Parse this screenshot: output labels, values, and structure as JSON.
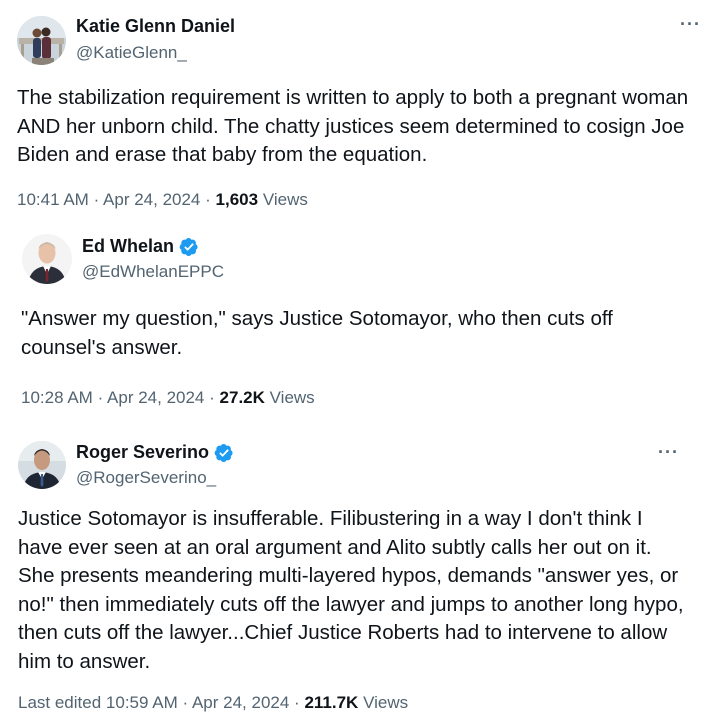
{
  "tweets": [
    {
      "author": {
        "name": "Katie Glenn Daniel",
        "handle": "@KatieGlenn_",
        "verified": false,
        "avatar_icon": "couple-photo-avatar"
      },
      "more_label": "···",
      "text": "The stabilization requirement is written to apply to both a pregnant woman AND her unborn child. The chatty justices seem determined to cosign Joe Biden and erase that baby from the equation.",
      "time": "10:41 AM",
      "date": "Apr 24, 2024",
      "views_count": "1,603",
      "views_label": "Views",
      "separator": "·"
    },
    {
      "author": {
        "name": "Ed Whelan",
        "handle": "@EdWhelanEPPC",
        "verified": true,
        "avatar_icon": "man-portrait-avatar"
      },
      "text": "\"Answer my question,\" says Justice Sotomayor, who then cuts off counsel's answer.",
      "time": "10:28 AM",
      "date": "Apr 24, 2024",
      "views_count": "27.2K",
      "views_label": "Views",
      "separator": "·"
    },
    {
      "author": {
        "name": "Roger Severino",
        "handle": "@RogerSeverino_",
        "verified": true,
        "avatar_icon": "man-portrait-avatar"
      },
      "more_label": "···",
      "text": "Justice Sotomayor is insufferable. Filibustering in a way I don't think I have ever seen at an oral argument and Alito subtly calls her out on it. She presents meandering multi-layered hypos, demands \"answer yes, or no!\" then immediately cuts off the lawyer and jumps to another long hypo, then cuts off the lawyer...Chief Justice Roberts had to intervene to allow him to answer.",
      "edited_prefix": "Last edited",
      "time": "10:59 AM",
      "date": "Apr 24, 2024",
      "views_count": "211.7K",
      "views_label": "Views",
      "separator": "·"
    }
  ],
  "colors": {
    "text_primary": "#0f1419",
    "text_secondary": "#536471",
    "verified_blue": "#1d9bf0"
  }
}
